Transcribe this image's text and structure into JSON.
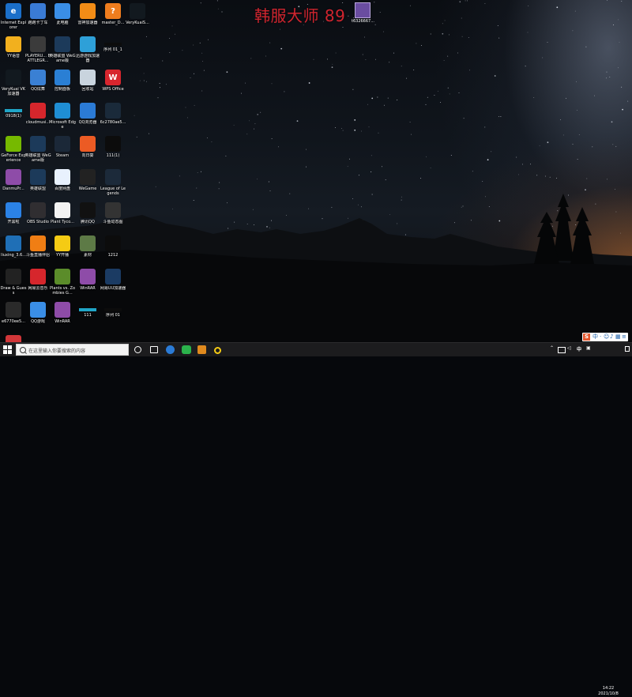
{
  "overlay": {
    "streamer_title": "韩服大师 89",
    "file_label": "t6326667..."
  },
  "icons": [
    {
      "label": "Internet Explorer",
      "color": "#1b6fc9",
      "glyph": "e",
      "name": "internet-explorer-icon"
    },
    {
      "label": "跑跑卡丁车",
      "color": "#3a7bd5",
      "glyph": "",
      "name": "kartrider-icon"
    },
    {
      "label": "此电脑",
      "color": "#3a8ee6",
      "glyph": "",
      "name": "this-pc-icon"
    },
    {
      "label": "雷神加速器",
      "color": "#f28c16",
      "glyph": "",
      "name": "leishen-accelerator-icon"
    },
    {
      "label": "master_D...",
      "color": "#ef7d1e",
      "glyph": "?",
      "name": "master-d-icon"
    },
    {
      "label": "VeryKuaiS...",
      "color": "#12191f",
      "glyph": "",
      "name": "verykuai-s-icon"
    },
    {
      "label": "YY语音",
      "color": "#f2b01e",
      "glyph": "",
      "name": "yy-voice-icon"
    },
    {
      "label": "PLAYERU... BATTLEGR...",
      "color": "#3b3b3b",
      "glyph": "",
      "name": "pubg-icon"
    },
    {
      "label": "英雄联盟 WeGame版",
      "color": "#1c3a5a",
      "glyph": "",
      "name": "lol-wegame-icon"
    },
    {
      "label": "迅游游戏加速器",
      "color": "#2ea0d8",
      "glyph": "",
      "name": "xunyou-accelerator-icon"
    },
    {
      "label": "序列 01_1",
      "color": "#0c0c0c",
      "glyph": "",
      "name": "sequence-01-1-icon"
    },
    {
      "label": "VeryKuai VK 加速器",
      "color": "#12191f",
      "glyph": "",
      "name": "verykuai-vk-icon"
    },
    {
      "label": "QQ炫舞",
      "color": "#3a80d4",
      "glyph": "",
      "name": "qq-xuanwu-icon"
    },
    {
      "label": "控制面板",
      "color": "#2a7fd4",
      "glyph": "",
      "name": "control-panel-icon"
    },
    {
      "label": "回收站",
      "color": "#c9d4de",
      "glyph": "",
      "name": "recycle-bin-icon"
    },
    {
      "label": "WPS Office",
      "color": "#d7262e",
      "glyph": "W",
      "name": "wps-office-icon"
    },
    {
      "label": "0918(1)",
      "color": "#20a6c8",
      "glyph": "",
      "name": "file-0918-icon"
    },
    {
      "label": "cloudmusi...",
      "color": "#d6262c",
      "glyph": "",
      "name": "cloudmusic-icon"
    },
    {
      "label": "Microsoft Edge",
      "color": "#1f8ed4",
      "glyph": "",
      "name": "microsoft-edge-icon"
    },
    {
      "label": "QQ浏览器",
      "color": "#2b7bd6",
      "glyph": "",
      "name": "qq-browser-icon"
    },
    {
      "label": "6c2780ae5...",
      "color": "#1a2a3a",
      "glyph": "",
      "name": "file-6c2780-icon"
    },
    {
      "label": "GeForce Experience",
      "color": "#76b900",
      "glyph": "",
      "name": "geforce-experience-icon"
    },
    {
      "label": "英雄联盟 WeGame版",
      "color": "#1c3a5a",
      "glyph": "",
      "name": "lol-wegame-2-icon"
    },
    {
      "label": "Steam",
      "color": "#1b2838",
      "glyph": "",
      "name": "steam-icon"
    },
    {
      "label": "向日葵",
      "color": "#ec5b24",
      "glyph": "",
      "name": "sunlogin-icon"
    },
    {
      "label": "111(1)",
      "color": "#0c0c0c",
      "glyph": "",
      "name": "file-111-1-icon"
    },
    {
      "label": "DanmuPr...",
      "color": "#8e4ca8",
      "glyph": "",
      "name": "danmupr-icon"
    },
    {
      "label": "英雄联盟",
      "color": "#1c3a5a",
      "glyph": "",
      "name": "lol-icon"
    },
    {
      "label": "百度网盘",
      "color": "#e8f1fd",
      "glyph": "",
      "name": "baidu-netdisk-icon"
    },
    {
      "label": "WeGame",
      "color": "#222",
      "glyph": "",
      "name": "wegame-icon"
    },
    {
      "label": "League of Legends",
      "color": "#1c2a3a",
      "glyph": "",
      "name": "league-of-legends-icon"
    },
    {
      "label": "开黑啦",
      "color": "#2b82e6",
      "glyph": "",
      "name": "kaiheila-icon"
    },
    {
      "label": "OBS Studio",
      "color": "#302e31",
      "glyph": "",
      "name": "obs-studio-icon"
    },
    {
      "label": "Plant Tyco...",
      "color": "#f3f3f3",
      "glyph": "",
      "name": "plant-tycoon-icon"
    },
    {
      "label": "腾讯QQ",
      "color": "#111",
      "glyph": "",
      "name": "tencent-qq-icon"
    },
    {
      "label": "斗鱼动态图",
      "color": "#333",
      "glyph": "",
      "name": "douyu-gif-icon"
    },
    {
      "label": "liuxing_3.6...",
      "color": "#1f6fb6",
      "glyph": "",
      "name": "liuxing-icon"
    },
    {
      "label": "斗鱼直播伴侣",
      "color": "#f07e14",
      "glyph": "",
      "name": "douyu-companion-icon"
    },
    {
      "label": "YY开播",
      "color": "#f5cb14",
      "glyph": "",
      "name": "yy-live-icon"
    },
    {
      "label": "素材",
      "color": "#5d7a46",
      "glyph": "",
      "name": "material-folder-icon"
    },
    {
      "label": "1212",
      "color": "#0c0c0c",
      "glyph": "",
      "name": "file-1212-icon"
    },
    {
      "label": "Draw & Guess",
      "color": "#222",
      "glyph": "",
      "name": "draw-and-guess-icon"
    },
    {
      "label": "网易云音乐",
      "color": "#d6262c",
      "glyph": "",
      "name": "netease-music-icon"
    },
    {
      "label": "Plants vs. Zombies G...",
      "color": "#5b8c2a",
      "glyph": "",
      "name": "plants-vs-zombies-icon"
    },
    {
      "label": "WinRAR",
      "color": "#8e4ca8",
      "glyph": "",
      "name": "winrar-icon"
    },
    {
      "label": "网易UU加速器",
      "color": "#1b3b63",
      "glyph": "",
      "name": "uu-accelerator-icon"
    },
    {
      "label": "e6770ee5...",
      "color": "#2a2a2a",
      "glyph": "",
      "name": "file-e6770-icon"
    },
    {
      "label": "QQ游戏",
      "color": "#3a8ee6",
      "glyph": "",
      "name": "qq-game-icon"
    },
    {
      "label": "WinRAR",
      "color": "#8e4ca8",
      "glyph": "",
      "name": "winrar-2-icon"
    },
    {
      "label": "111",
      "color": "#20a6c8",
      "glyph": "",
      "name": "file-111-icon"
    },
    {
      "label": "序列 01",
      "color": "#0c0c0c",
      "glyph": "",
      "name": "sequence-01-icon"
    },
    {
      "label": "Riot客户端",
      "color": "#d13639",
      "glyph": "",
      "name": "riot-client-icon"
    }
  ],
  "taskbar": {
    "search_placeholder": "在这里输入你要搜索的内容",
    "ime_lang": "中",
    "time": "14:22",
    "date": "2021/10/8"
  }
}
